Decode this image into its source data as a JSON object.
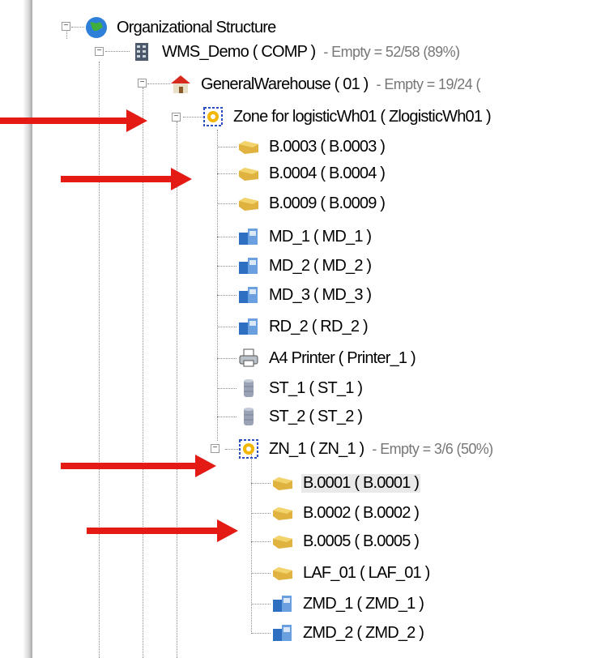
{
  "tree": {
    "rows": [
      {
        "label": "Organizational Structure",
        "suffix": "",
        "icon": "globe-icon"
      },
      {
        "label": "WMS_Demo ( COMP )",
        "suffix": "- Empty = 52/58 (89%)",
        "icon": "building-icon"
      },
      {
        "label": "GeneralWarehouse ( 01 )",
        "suffix": "- Empty = 19/24 (",
        "icon": "warehouse-icon"
      },
      {
        "label": "Zone for logisticWh01 ( ZlogisticWh01 )",
        "suffix": "",
        "icon": "zone-icon"
      },
      {
        "label": "B.0003 ( B.0003 )",
        "suffix": "",
        "icon": "bin-icon"
      },
      {
        "label": "B.0004 ( B.0004 )",
        "suffix": "",
        "icon": "bin-icon"
      },
      {
        "label": "B.0009 ( B.0009 )",
        "suffix": "",
        "icon": "bin-icon"
      },
      {
        "label": "MD_1 ( MD_1 )",
        "suffix": "",
        "icon": "mobile-device-icon"
      },
      {
        "label": "MD_2 ( MD_2 )",
        "suffix": "",
        "icon": "mobile-device-icon"
      },
      {
        "label": "MD_3 ( MD_3 )",
        "suffix": "",
        "icon": "mobile-device-icon"
      },
      {
        "label": "RD_2 ( RD_2 )",
        "suffix": "",
        "icon": "mobile-device-icon"
      },
      {
        "label": "A4 Printer ( Printer_1 )",
        "suffix": "",
        "icon": "printer-icon"
      },
      {
        "label": "ST_1 ( ST_1 )",
        "suffix": "",
        "icon": "storage-icon"
      },
      {
        "label": "ST_2 ( ST_2 )",
        "suffix": "",
        "icon": "storage-icon"
      },
      {
        "label": "ZN_1 ( ZN_1 )",
        "suffix": "- Empty = 3/6 (50%)",
        "icon": "zone-icon"
      },
      {
        "label": "B.0001 ( B.0001 )",
        "suffix": "",
        "icon": "bin-icon"
      },
      {
        "label": "B.0002 ( B.0002 )",
        "suffix": "",
        "icon": "bin-icon"
      },
      {
        "label": "B.0005 ( B.0005 )",
        "suffix": "",
        "icon": "bin-icon"
      },
      {
        "label": "LAF_01 ( LAF_01 )",
        "suffix": "",
        "icon": "bin-icon"
      },
      {
        "label": "ZMD_1 ( ZMD_1 )",
        "suffix": "",
        "icon": "mobile-device-icon"
      },
      {
        "label": "ZMD_2 ( ZMD_2 )",
        "suffix": "",
        "icon": "mobile-device-icon"
      }
    ]
  },
  "annotations": {
    "arrow_color": "#e31b14"
  }
}
